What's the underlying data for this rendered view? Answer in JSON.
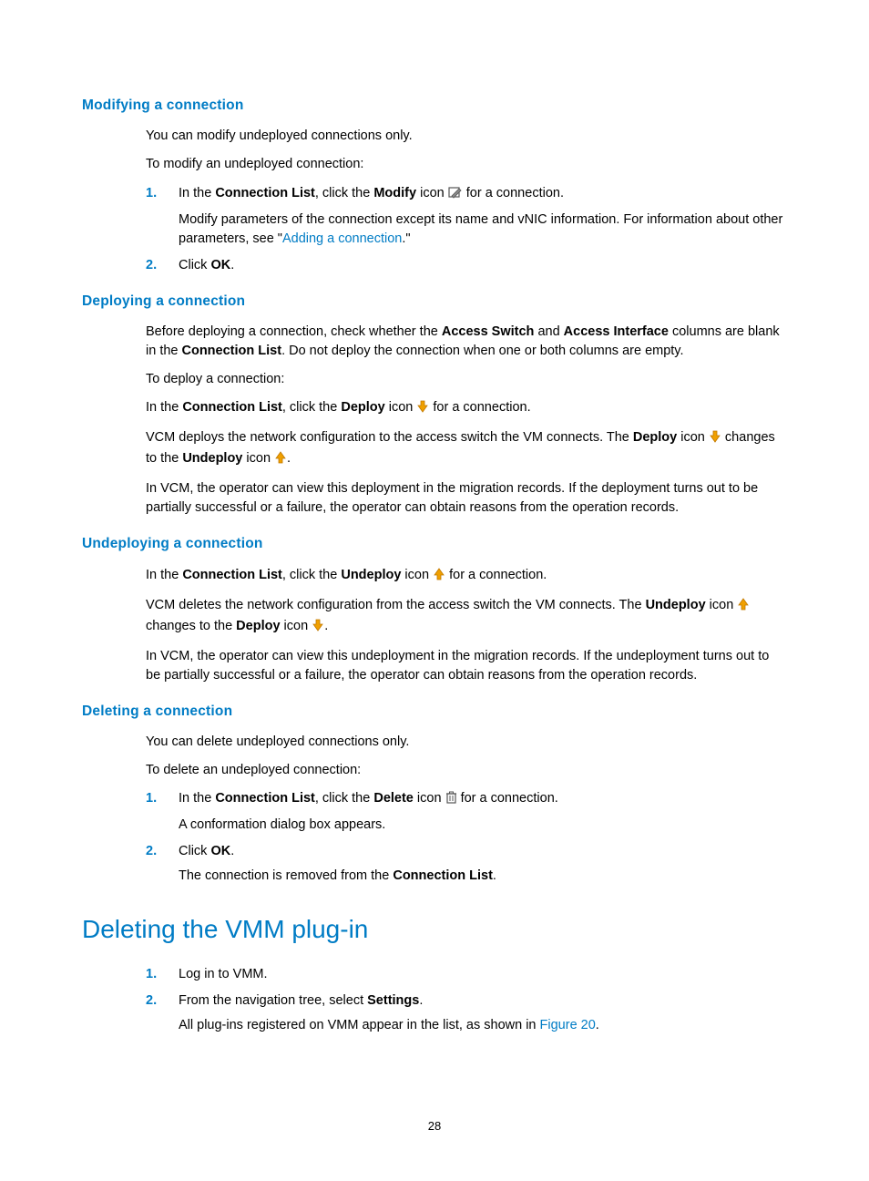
{
  "page_number": "28",
  "sections": {
    "modifying": {
      "heading": "Modifying a connection",
      "p1": "You can modify undeployed connections only.",
      "p2": "To modify an undeployed connection:",
      "step1_pre": "In the ",
      "step1_b1": "Connection List",
      "step1_mid": ", click the ",
      "step1_b2": "Modify",
      "step1_icon_label": " icon ",
      "step1_post": " for a connection.",
      "step1_note_pre": "Modify parameters of the connection except its name and vNIC information. For information about other parameters, see \"",
      "step1_link": "Adding a connection",
      "step1_note_post": ".\"",
      "step2_pre": "Click ",
      "step2_b": "OK",
      "step2_post": "."
    },
    "deploying": {
      "heading": "Deploying a connection",
      "p1_pre": "Before deploying a connection, check whether the ",
      "p1_b1": "Access Switch",
      "p1_mid1": " and ",
      "p1_b2": "Access Interface",
      "p1_mid2": " columns are blank in the ",
      "p1_b3": "Connection List",
      "p1_post": ". Do not deploy the connection when one or both columns are empty.",
      "p2": "To deploy a connection:",
      "p3_pre": "In the ",
      "p3_b1": "Connection List",
      "p3_mid": ", click the ",
      "p3_b2": "Deploy",
      "p3_icon_label": " icon ",
      "p3_post": " for a connection.",
      "p4_pre": "VCM deploys the network configuration to the access switch the VM connects. The ",
      "p4_b1": "Deploy",
      "p4_mid1": " icon ",
      "p4_mid2": " changes to the ",
      "p4_b2": "Undeploy",
      "p4_icon_label2": " icon ",
      "p4_post": ".",
      "p5": "In VCM, the operator can view this deployment in the migration records. If the deployment turns out to be partially successful or a failure, the operator can obtain reasons from the operation records."
    },
    "undeploying": {
      "heading": "Undeploying a connection",
      "p1_pre": "In the ",
      "p1_b1": "Connection List",
      "p1_mid": ", click the ",
      "p1_b2": "Undeploy",
      "p1_icon_label": " icon ",
      "p1_post": " for a connection.",
      "p2_pre": "VCM deletes the network configuration from the access switch the VM connects. The ",
      "p2_b1": "Undeploy",
      "p2_mid1": " icon ",
      "p2_mid2": " changes to the ",
      "p2_b2": "Deploy",
      "p2_icon_label2": " icon ",
      "p2_post": ".",
      "p3": "In VCM, the operator can view this undeployment in the migration records. If the undeployment turns out to be partially successful or a failure, the operator can obtain reasons from the operation records."
    },
    "deleting": {
      "heading": "Deleting a connection",
      "p1": "You can delete undeployed connections only.",
      "p2": "To delete an undeployed connection:",
      "step1_pre": "In the ",
      "step1_b1": "Connection List",
      "step1_mid": ", click the ",
      "step1_b2": "Delete",
      "step1_icon_label": " icon ",
      "step1_post": " for a connection.",
      "step1_note": "A conformation dialog box appears.",
      "step2_pre": "Click ",
      "step2_b": "OK",
      "step2_post": ".",
      "step2_note_pre": "The connection is removed from the ",
      "step2_note_b": "Connection List",
      "step2_note_post": "."
    },
    "deleting_plugin": {
      "heading": "Deleting the VMM plug-in",
      "step1": "Log in to VMM.",
      "step2_pre": "From the navigation tree, select ",
      "step2_b": "Settings",
      "step2_post": ".",
      "step2_note_pre": "All plug-ins registered on VMM appear in the list, as shown in ",
      "step2_link": "Figure 20",
      "step2_note_post": "."
    }
  },
  "list_numbers": {
    "n1": "1.",
    "n2": "2."
  }
}
